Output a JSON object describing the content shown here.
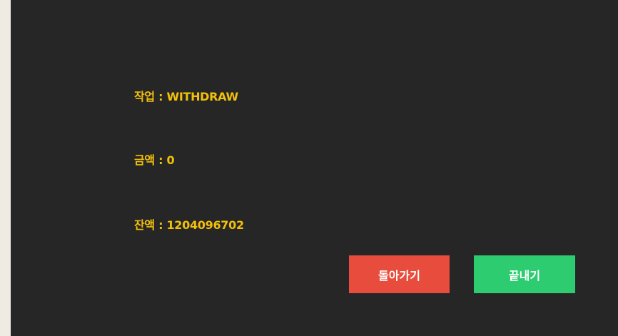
{
  "info": {
    "operation": "작업 : WITHDRAW",
    "amount": "금액 : 0",
    "balance": "잔액 : 1204096702"
  },
  "buttons": {
    "back_label": "돌아가기",
    "exit_label": "끝내기"
  },
  "colors": {
    "panel_background": "#262626",
    "outer_background": "#efebe3",
    "info_text": "#f2c00a",
    "back_button": "#e74c3c",
    "exit_button": "#2ecc71"
  }
}
